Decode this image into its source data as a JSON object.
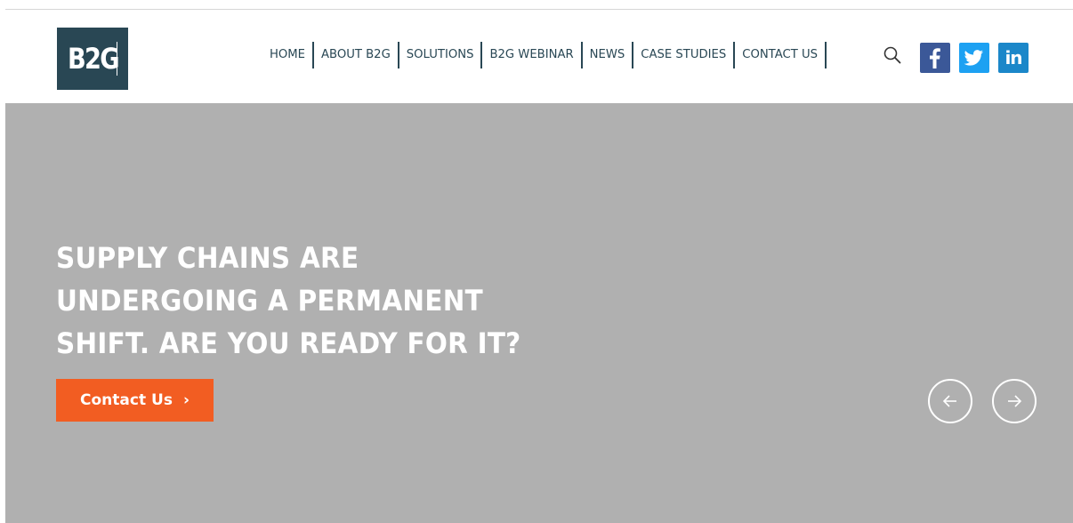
{
  "brand": {
    "logo_text": "B2G"
  },
  "nav": {
    "items": [
      {
        "label": "HOME"
      },
      {
        "label": "ABOUT B2G"
      },
      {
        "label": "SOLUTIONS"
      },
      {
        "label": "B2G WEBINAR"
      },
      {
        "label": "NEWS"
      },
      {
        "label": "CASE STUDIES"
      },
      {
        "label": "CONTACT US"
      }
    ]
  },
  "header_icons": {
    "search": "search-icon",
    "social": [
      {
        "name": "facebook-icon",
        "color": "#3b5898"
      },
      {
        "name": "twitter-icon",
        "color": "#1da1f2"
      },
      {
        "name": "linkedin-icon",
        "color": "#1b87c9",
        "glyph": "in"
      }
    ]
  },
  "hero": {
    "heading": "SUPPLY CHAINS ARE UNDERGOING A PERMANENT SHIFT. ARE YOU READY FOR IT?",
    "cta_label": "Contact Us",
    "cta_chevron": "›",
    "prev_icon": "arrow-left-icon",
    "next_icon": "arrow-right-icon"
  },
  "colors": {
    "brand_dark": "#294754",
    "accent_orange": "#f25d22",
    "hero_background": "#b0b0b0"
  }
}
